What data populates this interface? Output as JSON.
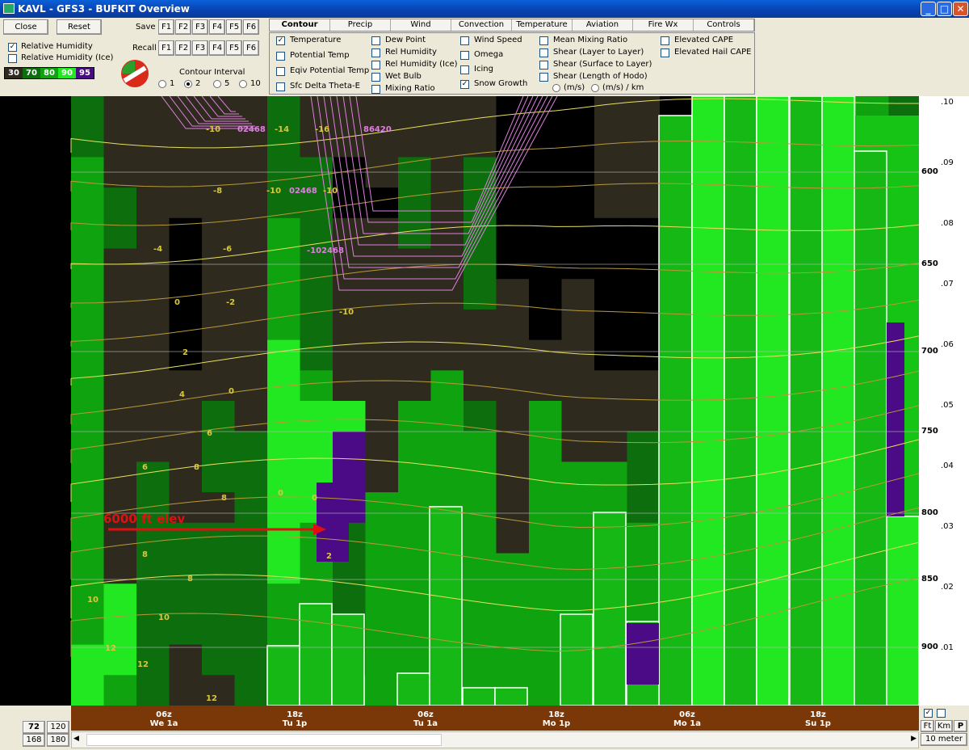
{
  "window": {
    "title": "KAVL - GFS3 - BUFKIT Overview"
  },
  "toolbar": {
    "close": "Close",
    "reset": "Reset",
    "save": "Save",
    "recall": "Recall",
    "fkeys": [
      "F1",
      "F2",
      "F3",
      "F4",
      "F5",
      "F6"
    ],
    "rh": "Relative Humidity",
    "rh_ice": "Relative Humidity (Ice)",
    "contour_interval": "Contour Interval",
    "intervals": [
      "1",
      "2",
      "5",
      "10"
    ],
    "legend": [
      {
        "label": "30",
        "color": "#2e2a1e"
      },
      {
        "label": "70",
        "color": "#0c6e0c"
      },
      {
        "label": "80",
        "color": "#0fa30f"
      },
      {
        "label": "90",
        "color": "#22e822"
      },
      {
        "label": "95",
        "color": "#4b0a86"
      }
    ]
  },
  "tabs": [
    "Contour",
    "Precip",
    "Wind",
    "Convection",
    "Temperature",
    "Aviation",
    "Fire Wx",
    "Controls"
  ],
  "options": {
    "col1": [
      "Temperature",
      "Potential Temp",
      "Eqiv Potential Temp",
      "Sfc Delta Theta-E"
    ],
    "col2": [
      "Dew Point",
      "Rel Humidity",
      "Rel Humidity (Ice)",
      "Wet Bulb",
      "Mixing Ratio"
    ],
    "col3": [
      "Wind Speed",
      "Omega",
      "Icing",
      "Snow Growth"
    ],
    "col4": [
      "Mean Mixing Ratio",
      "Shear (Layer to Layer)",
      "Shear (Surface to Layer)",
      "Shear (Length of Hodo)"
    ],
    "col4_units": [
      "(m/s)",
      "(m/s) / km"
    ],
    "col5": [
      "Elevated CAPE",
      "Elevated Hail CAPE"
    ]
  },
  "plot": {
    "annotation": "6000 ft elev",
    "pressure_labels": [
      "600",
      "650",
      "700",
      "750",
      "800",
      "850",
      "900"
    ],
    "omega_labels": [
      ".10",
      ".09",
      ".08",
      ".07",
      ".06",
      ".05",
      ".04",
      ".03",
      ".02",
      ".01"
    ],
    "contour_labels": [
      "-10",
      "-14",
      "-16",
      "-8",
      "-6",
      "-4",
      "-2",
      "0",
      "2",
      "4",
      "6",
      "8",
      "10",
      "12",
      "02468",
      "86420",
      "-102468"
    ]
  },
  "timeline": {
    "labels": [
      {
        "top": "06z",
        "bottom": "We 1a"
      },
      {
        "top": "18z",
        "bottom": "Tu 1p"
      },
      {
        "top": "06z",
        "bottom": "Tu 1a"
      },
      {
        "top": "18z",
        "bottom": "Mo 1p"
      },
      {
        "top": "06z",
        "bottom": "Mo 1a"
      },
      {
        "top": "18z",
        "bottom": "Su 1p"
      }
    ]
  },
  "bottom": {
    "h72": "72",
    "h120": "120",
    "h168": "168",
    "h180": "180",
    "ft": "Ft",
    "km": "Km",
    "p": "P",
    "meter": "10 meter"
  }
}
